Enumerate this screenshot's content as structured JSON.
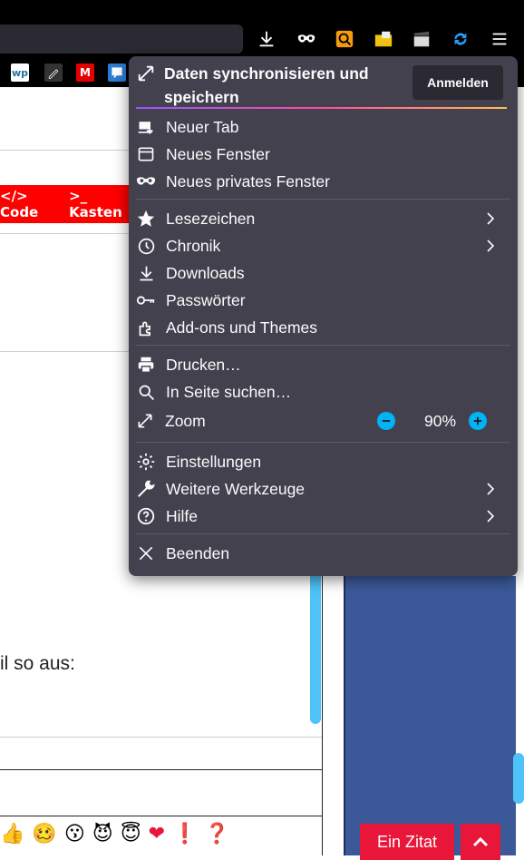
{
  "menu": {
    "sync_title_line1": "Daten synchronisieren und",
    "sync_title_line2": "speichern",
    "sign_in_label": "Anmelden",
    "items": {
      "new_tab": "Neuer Tab",
      "new_window": "Neues Fenster",
      "private_window": "Neues privates Fenster",
      "bookmarks": "Lesezeichen",
      "history": "Chronik",
      "downloads": "Downloads",
      "passwords": "Passwörter",
      "addons": "Add-ons und Themes",
      "print": "Drucken…",
      "find": "In Seite suchen…",
      "zoom": "Zoom",
      "settings": "Einstellungen",
      "more_tools": "Weitere Werkzeuge",
      "help": "Hilfe",
      "quit": "Beenden"
    },
    "zoom_value": "90%"
  },
  "page": {
    "redbar_code": "</> Code",
    "redbar_box": ">_ Kasten",
    "body_text": "il so aus:",
    "quote_button": "Ein Zitat"
  },
  "bookmarks": {
    "bm1": "wp",
    "bm3": "M"
  },
  "colors": {
    "menu_bg": "#42414d",
    "accent_blue": "#00b3f4",
    "red": "#ff0000"
  }
}
